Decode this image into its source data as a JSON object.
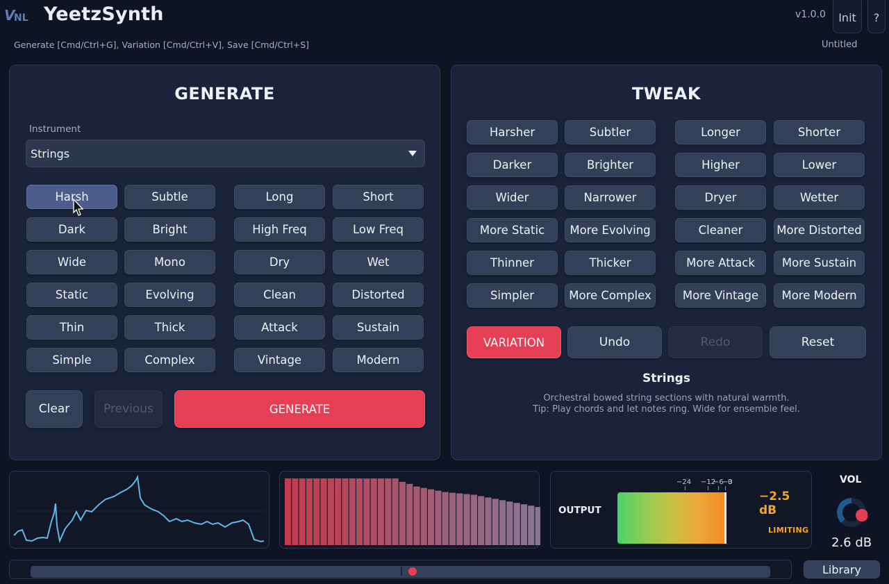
{
  "header": {
    "logo_text": "VNL",
    "title": "YeetzSynth",
    "shortcuts": "Generate [Cmd/Ctrl+G], Variation [Cmd/Ctrl+V], Save [Cmd/Ctrl+S]",
    "version": "v1.0.0",
    "init_label": "Init",
    "help_label": "?",
    "preset_name": "Untitled"
  },
  "generate": {
    "title": "GENERATE",
    "instrument_label": "Instrument",
    "instrument_value": "Strings",
    "tags": [
      "Harsh",
      "Subtle",
      "Long",
      "Short",
      "Dark",
      "Bright",
      "High Freq",
      "Low Freq",
      "Wide",
      "Mono",
      "Dry",
      "Wet",
      "Static",
      "Evolving",
      "Clean",
      "Distorted",
      "Thin",
      "Thick",
      "Attack",
      "Sustain",
      "Simple",
      "Complex",
      "Vintage",
      "Modern"
    ],
    "active_tag": "Harsh",
    "clear_label": "Clear",
    "previous_label": "Previous",
    "generate_label": "GENERATE"
  },
  "tweak": {
    "title": "TWEAK",
    "tags": [
      "Harsher",
      "Subtler",
      "Longer",
      "Shorter",
      "Darker",
      "Brighter",
      "Higher",
      "Lower",
      "Wider",
      "Narrower",
      "Dryer",
      "Wetter",
      "More Static",
      "More Evolving",
      "Cleaner",
      "More Distorted",
      "Thinner",
      "Thicker",
      "More Attack",
      "More Sustain",
      "Simpler",
      "More Complex",
      "More Vintage",
      "More Modern"
    ],
    "variation_label": "VARIATION",
    "undo_label": "Undo",
    "redo_label": "Redo",
    "reset_label": "Reset",
    "desc_name": "Strings",
    "desc_line1": "Orchestral bowed string sections with natural warmth.",
    "desc_line2": "Tip: Play chords and let notes ring. Wide for ensemble feel."
  },
  "output": {
    "label": "OUTPUT",
    "ticks": [
      "−24",
      "−12",
      "−6",
      "−3",
      "0"
    ],
    "level_db": "−2.5 dB",
    "limiting": "LIMITING"
  },
  "volume": {
    "label": "VOL",
    "value": "2.6 dB"
  },
  "library_label": "Library",
  "colors": {
    "accent": "#e63e54",
    "wave": "#5fb8e8",
    "panel": "#1a2339",
    "button": "#34405a",
    "warning": "#f5a623"
  },
  "spectrum_bars": [
    0.98,
    0.98,
    0.98,
    0.98,
    0.98,
    0.98,
    0.98,
    0.98,
    0.98,
    0.98,
    0.98,
    0.98,
    0.98,
    0.98,
    0.98,
    0.98,
    0.93,
    0.9,
    0.86,
    0.84,
    0.82,
    0.8,
    0.78,
    0.77,
    0.76,
    0.75,
    0.74,
    0.72,
    0.7,
    0.68,
    0.66,
    0.64,
    0.62,
    0.6,
    0.58,
    0.56
  ]
}
